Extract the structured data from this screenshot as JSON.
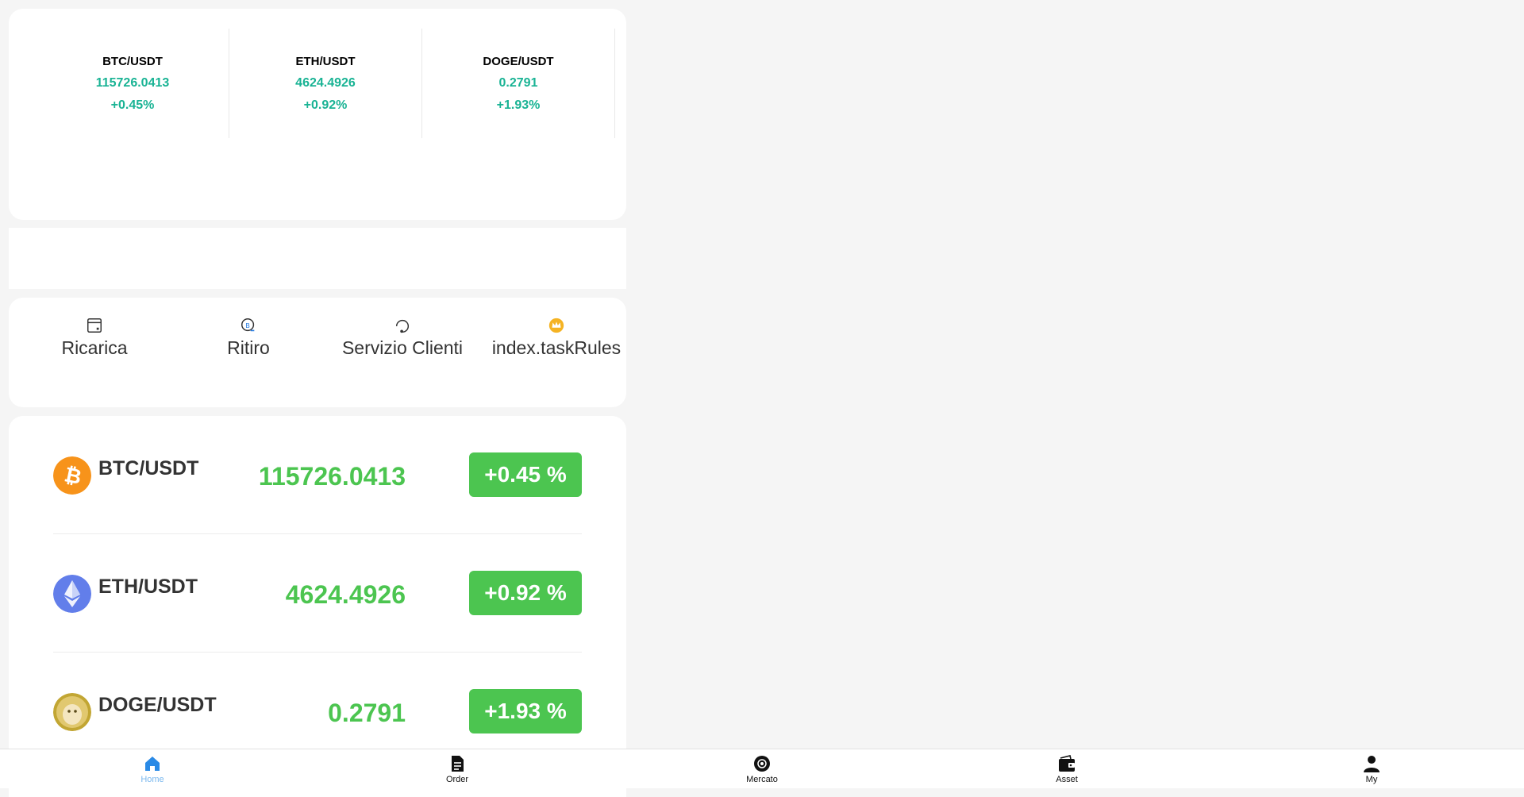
{
  "tickers": [
    {
      "pair": "BTC/USDT",
      "price": "115726.0413",
      "change": "+0.45%"
    },
    {
      "pair": "ETH/USDT",
      "price": "4624.4926",
      "change": "+0.92%"
    },
    {
      "pair": "DOGE/USDT",
      "price": "0.2791",
      "change": "+1.93%"
    }
  ],
  "actions": [
    {
      "label": "Ricarica",
      "icon": "wallet-card-icon"
    },
    {
      "label": "Ritiro",
      "icon": "withdraw-coin-icon"
    },
    {
      "label": "Servizio Clienti",
      "icon": "support-headset-icon"
    },
    {
      "label": "index.taskRules",
      "icon": "crown-badge-icon"
    }
  ],
  "market": [
    {
      "pair": "BTC/USDT",
      "price": "115726.0413",
      "change": "+0.45 %",
      "icon": "bitcoin-icon",
      "color": "#f7931a"
    },
    {
      "pair": "ETH/USDT",
      "price": "4624.4926",
      "change": "+0.92 %",
      "icon": "ethereum-icon",
      "color": "#627eea"
    },
    {
      "pair": "DOGE/USDT",
      "price": "0.2791",
      "change": "+1.93 %",
      "icon": "dogecoin-icon",
      "color": "#c2a633"
    }
  ],
  "nav": [
    {
      "label": "Home",
      "icon": "home-icon",
      "active": true
    },
    {
      "label": "Order",
      "icon": "document-icon",
      "active": false
    },
    {
      "label": "Mercato",
      "icon": "market-coin-icon",
      "active": false
    },
    {
      "label": "Asset",
      "icon": "wallet-icon",
      "active": false
    },
    {
      "label": "My",
      "icon": "user-icon",
      "active": false
    }
  ],
  "colors": {
    "up": "#19b394",
    "badge": "#4cc550",
    "nav_active": "#7ab8ee"
  }
}
